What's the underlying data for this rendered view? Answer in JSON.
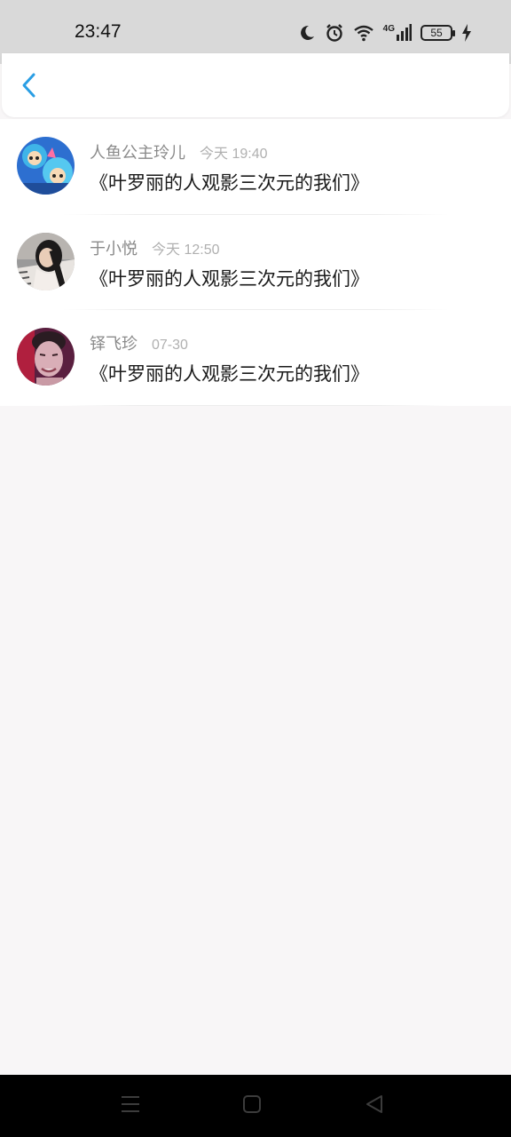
{
  "status_bar": {
    "time": "23:47",
    "network": "4G",
    "battery_level": "55",
    "icons": [
      "moon-icon",
      "alarm-icon",
      "wifi-icon",
      "signal-icon",
      "battery-icon",
      "charging-icon"
    ]
  },
  "header": {
    "back_icon": "chevron-left-icon",
    "accent_color": "#2a9ee4"
  },
  "comments": [
    {
      "name": "人鱼公主玲儿",
      "time": "今天 19:40",
      "text": "《叶罗丽的人观影三次元的我们》"
    },
    {
      "name": "于小悦",
      "time": "今天 12:50",
      "text": "《叶罗丽的人观影三次元的我们》"
    },
    {
      "name": "铎飞珍",
      "time": "07-30",
      "text": "《叶罗丽的人观影三次元的我们》"
    }
  ],
  "nav_bar": {
    "icons": [
      "menu-icon",
      "home-square-icon",
      "back-triangle-icon"
    ]
  }
}
